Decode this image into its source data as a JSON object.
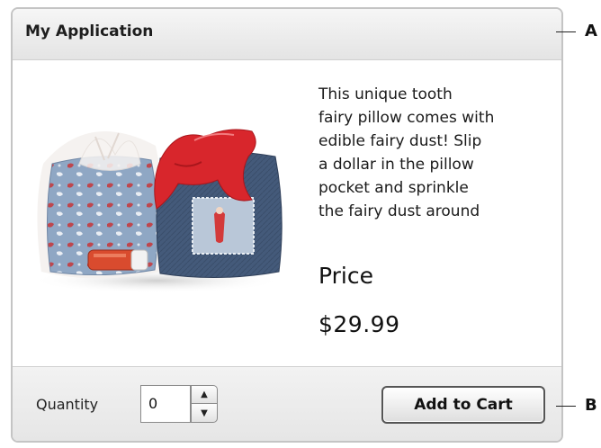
{
  "header": {
    "title": "My Application"
  },
  "product": {
    "image_icon": "pillows-photo",
    "description": "This unique tooth\nfairy pillow comes with\nedible fairy dust! Slip\na dollar in the pillow\npocket and sprinkle\nthe fairy dust around",
    "price_label": "Price",
    "price_value": "$29.99"
  },
  "footer": {
    "quantity_label": "Quantity",
    "quantity_value": "0",
    "stepper_up_icon": "arrow-up-icon",
    "stepper_down_icon": "arrow-down-icon",
    "add_to_cart_label": "Add to Cart"
  },
  "callouts": {
    "a": "A",
    "b": "B"
  },
  "colors": {
    "header_bg": "#e8e8e8",
    "footer_bg": "#ececec",
    "pillow_light_blue": "#8aa3c2",
    "pillow_dark_blue": "#3f5473",
    "bandana_red": "#d8262c"
  }
}
